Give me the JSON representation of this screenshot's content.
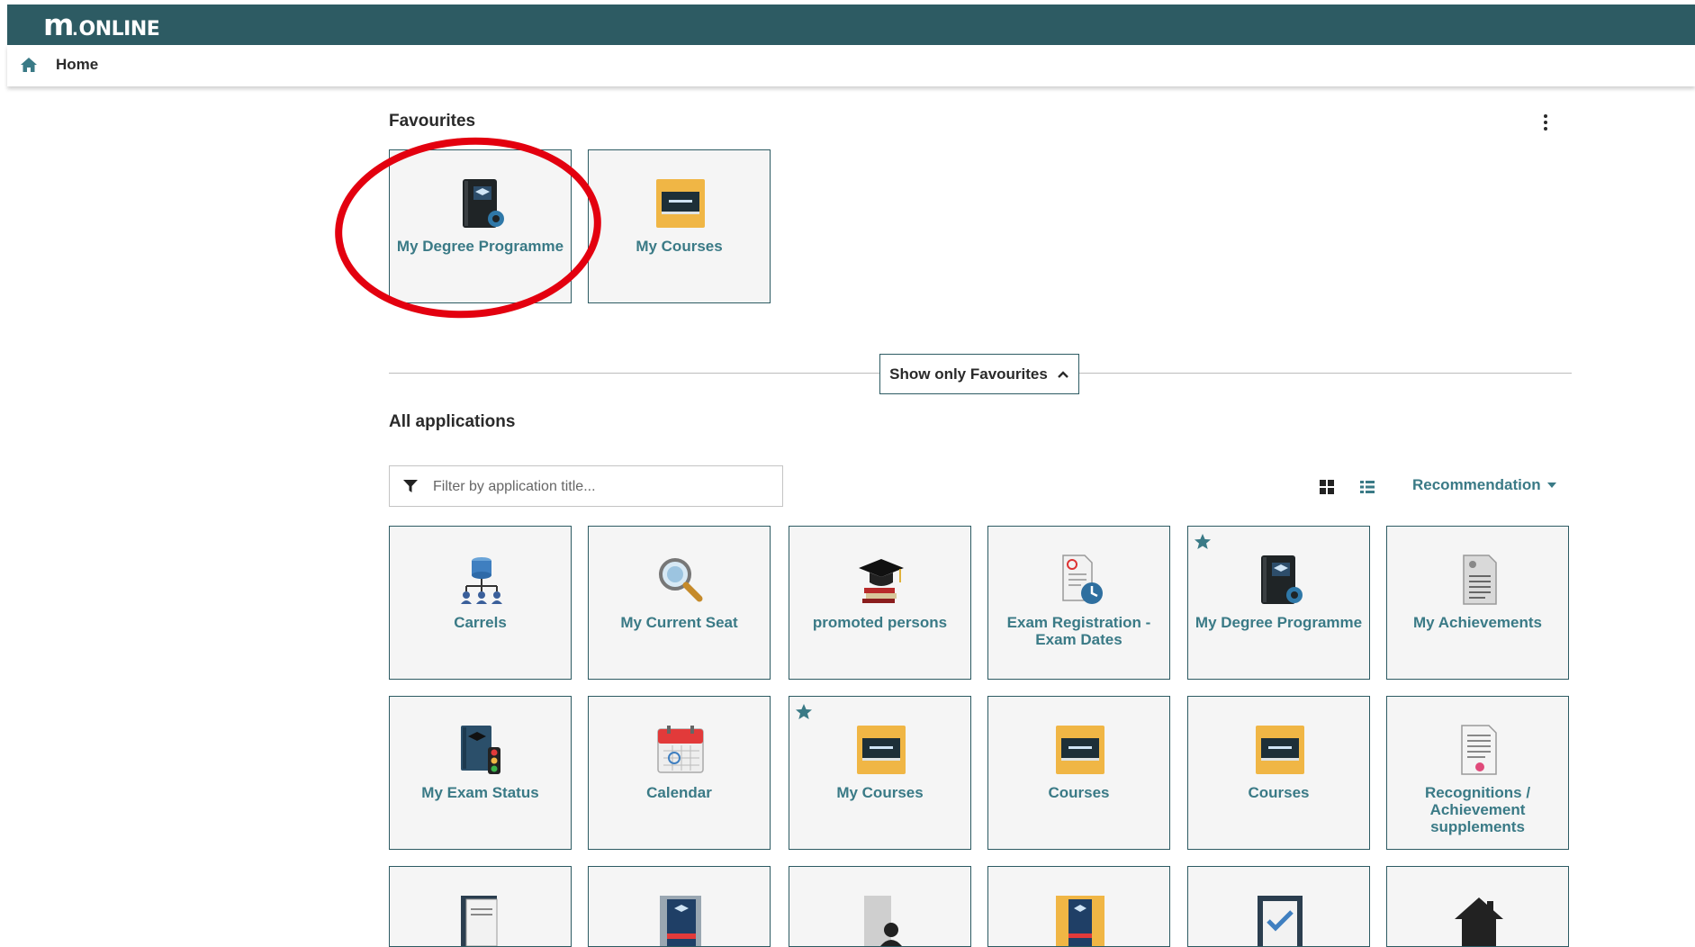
{
  "header": {
    "logo_mark": "m",
    "logo_word": "ONLINE"
  },
  "breadcrumb": {
    "home_label": "Home"
  },
  "favourites": {
    "title": "Favourites",
    "tiles": [
      {
        "label": "My Degree Programme",
        "icon": "degree-programme-book-icon"
      },
      {
        "label": "My Courses",
        "icon": "courses-board-icon"
      }
    ]
  },
  "toggle": {
    "label": "Show only Favourites"
  },
  "all_apps": {
    "title": "All applications",
    "filter_placeholder": "Filter by application title...",
    "sort_label": "Recommendation",
    "tiles": [
      {
        "label": "Carrels",
        "icon": "carrels-network-icon",
        "favourite": false
      },
      {
        "label": "My Current Seat",
        "icon": "magnifier-icon",
        "favourite": false
      },
      {
        "label": "promoted persons",
        "icon": "graduation-cap-icon",
        "favourite": false
      },
      {
        "label": "Exam Registration - Exam Dates",
        "icon": "exam-document-clock-icon",
        "favourite": false
      },
      {
        "label": "My Degree Programme",
        "icon": "degree-programme-book-icon",
        "favourite": true
      },
      {
        "label": "My Achievements",
        "icon": "achievements-document-icon",
        "favourite": false
      },
      {
        "label": "My Exam Status",
        "icon": "exam-status-traffic-light-icon",
        "favourite": false
      },
      {
        "label": "Calendar",
        "icon": "calendar-icon",
        "favourite": false
      },
      {
        "label": "My Courses",
        "icon": "courses-board-icon",
        "favourite": true
      },
      {
        "label": "Courses",
        "icon": "courses-board-icon",
        "favourite": false
      },
      {
        "label": "Courses",
        "icon": "courses-board-icon",
        "favourite": false
      },
      {
        "label": "Recognitions / Achievement supplements",
        "icon": "recognition-certificate-icon",
        "favourite": false
      }
    ],
    "partial_tiles": [
      "document-icon",
      "book-icon",
      "person-icon",
      "orange-book-icon",
      "checklist-icon",
      "house-icon"
    ]
  },
  "colors": {
    "header": "#2d5b63",
    "accent": "#3a7a86",
    "annotation": "#e3000f"
  }
}
